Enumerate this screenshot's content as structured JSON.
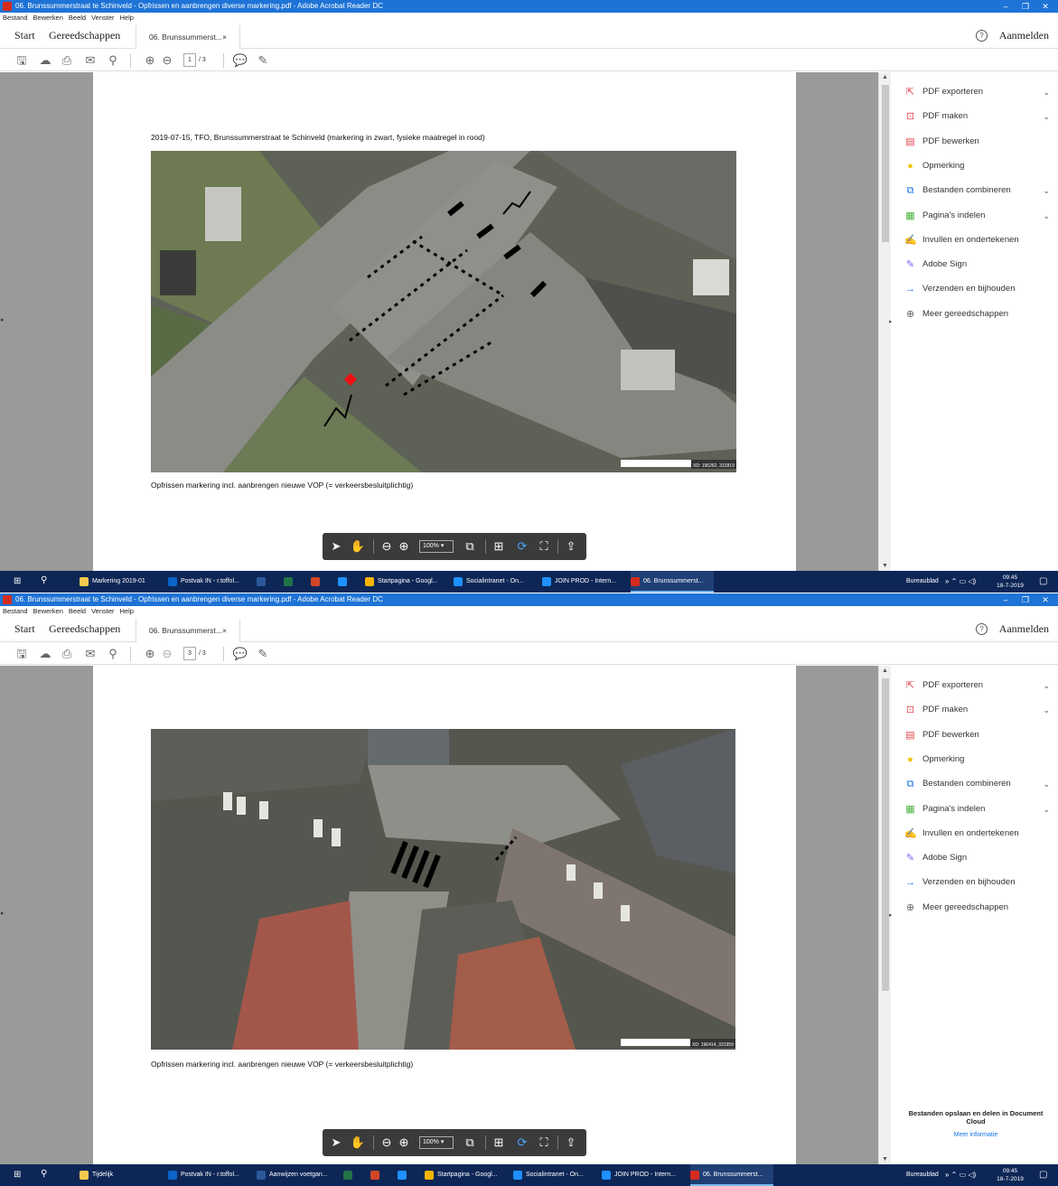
{
  "window": {
    "title": "06. Brunssummerstraat te Schinveld - Opfrissen en aanbrengen diverse markering.pdf - Adobe Acrobat Reader DC",
    "buttons": [
      "–",
      "❐",
      "✕"
    ]
  },
  "menu": [
    "Bestand",
    "Bewerken",
    "Beeld",
    "Venster",
    "Help"
  ],
  "tabs": {
    "start": "Start",
    "tools": "Gereedschappen",
    "document": "06. Brunssummerst...",
    "close": "×",
    "help": "?",
    "login": "Aanmelden"
  },
  "toolbar": {
    "icons": [
      "save-icon",
      "upload-icon",
      "print-icon",
      "mail-icon",
      "search-icon",
      "page-up-icon",
      "page-down-icon",
      "comment-icon",
      "pen-icon"
    ],
    "page_total": "/ 3"
  },
  "screenshots": [
    {
      "current_page": "1",
      "page_title": "2019-07-15, TFO, Brunssummerstraat te Schinveld (markering in zwart, fysieke maatregel in rood)",
      "caption": "Opfrissen markering incl. aanbrengen nieuwe VOP (= verkeersbesluitplichtig)",
      "map_coords": "XD: 196262, 331819"
    },
    {
      "current_page": "3",
      "page_title": "",
      "caption": "Opfrissen markering incl. aanbrengen nieuwe VOP (= verkeersbesluitplichtig)",
      "map_coords": "XD: 196414, 331959"
    }
  ],
  "float_toolbar": {
    "zoom": "100%"
  },
  "right_panel": {
    "items": [
      {
        "label": "PDF exporteren",
        "color": "#e34850",
        "chevron": true
      },
      {
        "label": "PDF maken",
        "color": "#e34850",
        "chevron": true
      },
      {
        "label": "PDF bewerken",
        "color": "#e34850",
        "chevron": false
      },
      {
        "label": "Opmerking",
        "color": "#f5c518",
        "chevron": false
      },
      {
        "label": "Bestanden combineren",
        "color": "#1473e6",
        "chevron": true
      },
      {
        "label": "Pagina's indelen",
        "color": "#4bb33f",
        "chevron": true
      },
      {
        "label": "Invullen en ondertekenen",
        "color": "#7b61ff",
        "chevron": false
      },
      {
        "label": "Adobe Sign",
        "color": "#7b61ff",
        "chevron": false
      },
      {
        "label": "Verzenden en bijhouden",
        "color": "#1473e6",
        "chevron": false
      },
      {
        "label": "Meer gereedschappen",
        "color": "#666666",
        "chevron": false
      }
    ],
    "chevron": "⌄",
    "promo_title": "Bestanden opslaan en delen in Document Cloud",
    "promo_link": "Meer informatie"
  },
  "taskbar": [
    {
      "items": [
        {
          "label": "Markering 2019-01",
          "color": "#f2c94c",
          "active": false
        },
        {
          "label": "Postvak IN - r.toffol...",
          "color": "#0a64c9",
          "active": false
        },
        {
          "label": "",
          "color": "#2b579a",
          "active": false
        },
        {
          "label": "",
          "color": "#217346",
          "active": false
        },
        {
          "label": "",
          "color": "#d24726",
          "active": false
        },
        {
          "label": "",
          "color": "#1e90ff",
          "active": false
        },
        {
          "label": "Startpagina - Googl...",
          "color": "#f4b400",
          "active": false
        },
        {
          "label": "Socialintranet - On...",
          "color": "#1e90ff",
          "active": false
        },
        {
          "label": "JOIN PROD - Intern...",
          "color": "#1e90ff",
          "active": false
        },
        {
          "label": "06. Brunssummerst...",
          "color": "#d52b1e",
          "active": true
        }
      ],
      "tray": "Bureaublad",
      "time": "09:45",
      "date": "18-7-2019"
    },
    {
      "items": [
        {
          "label": "Tijdelijk",
          "color": "#f2c94c",
          "active": false
        },
        {
          "label": "Postvak IN - r.toffol...",
          "color": "#0a64c9",
          "active": false
        },
        {
          "label": "Aanwijzen voetgan...",
          "color": "#2b579a",
          "active": false
        },
        {
          "label": "",
          "color": "#217346",
          "active": false
        },
        {
          "label": "",
          "color": "#d24726",
          "active": false
        },
        {
          "label": "",
          "color": "#1e90ff",
          "active": false
        },
        {
          "label": "Startpagina - Googl...",
          "color": "#f4b400",
          "active": false
        },
        {
          "label": "Socialintranet - On...",
          "color": "#1e90ff",
          "active": false
        },
        {
          "label": "JOIN PROD - Intern...",
          "color": "#1e90ff",
          "active": false
        },
        {
          "label": "06. Brunssummerst...",
          "color": "#d52b1e",
          "active": true
        }
      ],
      "tray": "Bureaublad",
      "time": "09:45",
      "date": "18-7-2019"
    }
  ]
}
